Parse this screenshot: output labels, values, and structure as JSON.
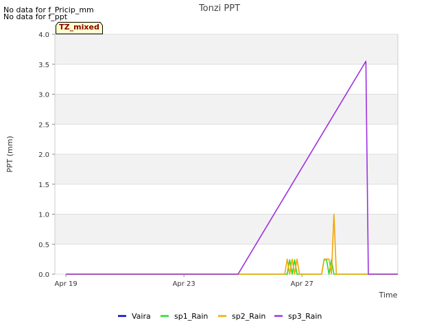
{
  "notes": [
    "No data for f_Pricip_mm",
    "No data for f_ppt"
  ],
  "badge": "TZ_mixed",
  "chart_data": {
    "type": "line",
    "title": "Tonzi PPT",
    "xlabel": "Time",
    "ylabel": "PPT (mm)",
    "ylim": [
      0.0,
      4.0
    ],
    "xlim": [
      "2024-04-18 15:00",
      "2024-04-30 06:00"
    ],
    "yticks": [
      "0.0",
      "0.5",
      "1.0",
      "1.5",
      "2.0",
      "2.5",
      "3.0",
      "3.5",
      "4.0"
    ],
    "xticks": [
      {
        "label": "Apr 19",
        "x": "2024-04-19 00:00"
      },
      {
        "label": "Apr 23",
        "x": "2024-04-23 00:00"
      },
      {
        "label": "Apr 27",
        "x": "2024-04-27 00:00"
      }
    ],
    "grid": true,
    "legend_position": "bottom",
    "series": [
      {
        "name": "Vaira",
        "color": "#0000cc",
        "points": []
      },
      {
        "name": "sp1_Rain",
        "color": "#22dd22",
        "points": [
          [
            "2024-04-19 00:00",
            0
          ],
          [
            "2024-04-26 12:00",
            0
          ],
          [
            "2024-04-26 14:00",
            0.24
          ],
          [
            "2024-04-26 16:00",
            0
          ],
          [
            "2024-04-26 18:00",
            0.24
          ],
          [
            "2024-04-26 20:00",
            0
          ],
          [
            "2024-04-27 16:00",
            0
          ],
          [
            "2024-04-27 18:00",
            0.24
          ],
          [
            "2024-04-27 20:00",
            0.24
          ],
          [
            "2024-04-27 22:00",
            0
          ],
          [
            "2024-04-28 00:00",
            0.24
          ],
          [
            "2024-04-28 02:00",
            0
          ],
          [
            "2024-04-30 06:00",
            0
          ]
        ]
      },
      {
        "name": "sp2_Rain",
        "color": "#f5a500",
        "points": [
          [
            "2024-04-19 00:00",
            0
          ],
          [
            "2024-04-26 10:00",
            0
          ],
          [
            "2024-04-26 12:00",
            0.25
          ],
          [
            "2024-04-26 14:00",
            0
          ],
          [
            "2024-04-26 16:00",
            0.25
          ],
          [
            "2024-04-26 18:00",
            0
          ],
          [
            "2024-04-26 20:00",
            0.25
          ],
          [
            "2024-04-26 22:00",
            0
          ],
          [
            "2024-04-27 16:00",
            0
          ],
          [
            "2024-04-27 18:00",
            0.25
          ],
          [
            "2024-04-27 20:00",
            0.25
          ],
          [
            "2024-04-27 22:00",
            0.25
          ],
          [
            "2024-04-28 00:00",
            0
          ],
          [
            "2024-04-28 02:00",
            1.0
          ],
          [
            "2024-04-28 04:00",
            0
          ],
          [
            "2024-04-30 06:00",
            0
          ]
        ]
      },
      {
        "name": "sp3_Rain",
        "color": "#9b30e0",
        "points": [
          [
            "2024-04-19 00:00",
            0
          ],
          [
            "2024-04-24 20:00",
            0
          ],
          [
            "2024-04-29 04:00",
            3.55
          ],
          [
            "2024-04-29 06:00",
            0
          ],
          [
            "2024-04-30 06:00",
            0
          ]
        ]
      }
    ]
  }
}
